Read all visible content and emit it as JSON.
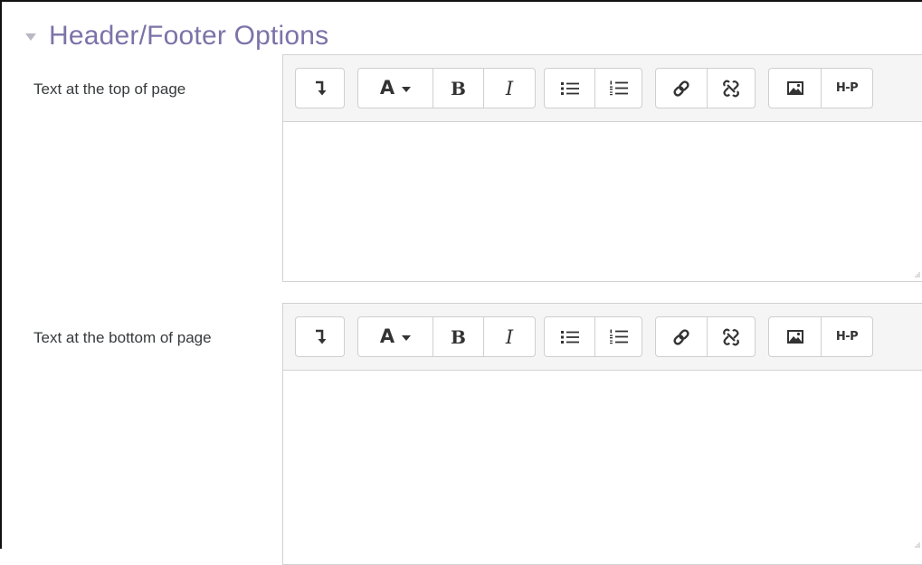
{
  "section": {
    "title": "Header/Footer Options",
    "collapse_icon": "caret-down-icon"
  },
  "fields": [
    {
      "label": "Text at the top of page",
      "content": ""
    },
    {
      "label": "Text at the bottom of page",
      "content": ""
    }
  ],
  "toolbar": {
    "font_label": "A",
    "bold_label": "B",
    "italic_label": "I",
    "h5p_label": "H-P",
    "icons": [
      "collapse-toolbar-icon",
      "font-style-icon",
      "bold-icon",
      "italic-icon",
      "unordered-list-icon",
      "ordered-list-icon",
      "link-icon",
      "unlink-icon",
      "image-icon",
      "h5p-icon"
    ]
  },
  "colors": {
    "section_title": "#7b73a8",
    "toolbar_bg": "#f5f5f5",
    "border": "#d2d2d2",
    "label_text": "#373a3c"
  }
}
